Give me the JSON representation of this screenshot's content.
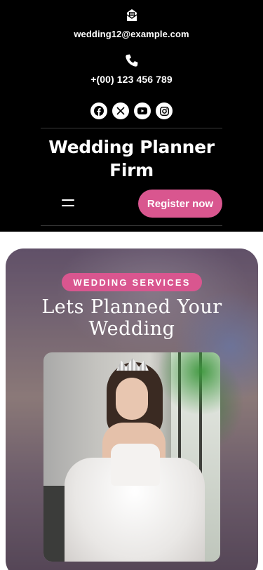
{
  "header": {
    "email": "wedding12@example.com",
    "phone": "+(00) 123 456 789",
    "social_icons": [
      "facebook-icon",
      "x-icon",
      "youtube-icon",
      "instagram-icon"
    ],
    "brand_title": "Wedding Planner Firm",
    "register_label": "Register now"
  },
  "hero": {
    "tag": "WEDDING SERVICES",
    "title": "Lets Planned Your Wedding"
  },
  "colors": {
    "accent": "#d9568f",
    "header_bg": "#000000"
  }
}
